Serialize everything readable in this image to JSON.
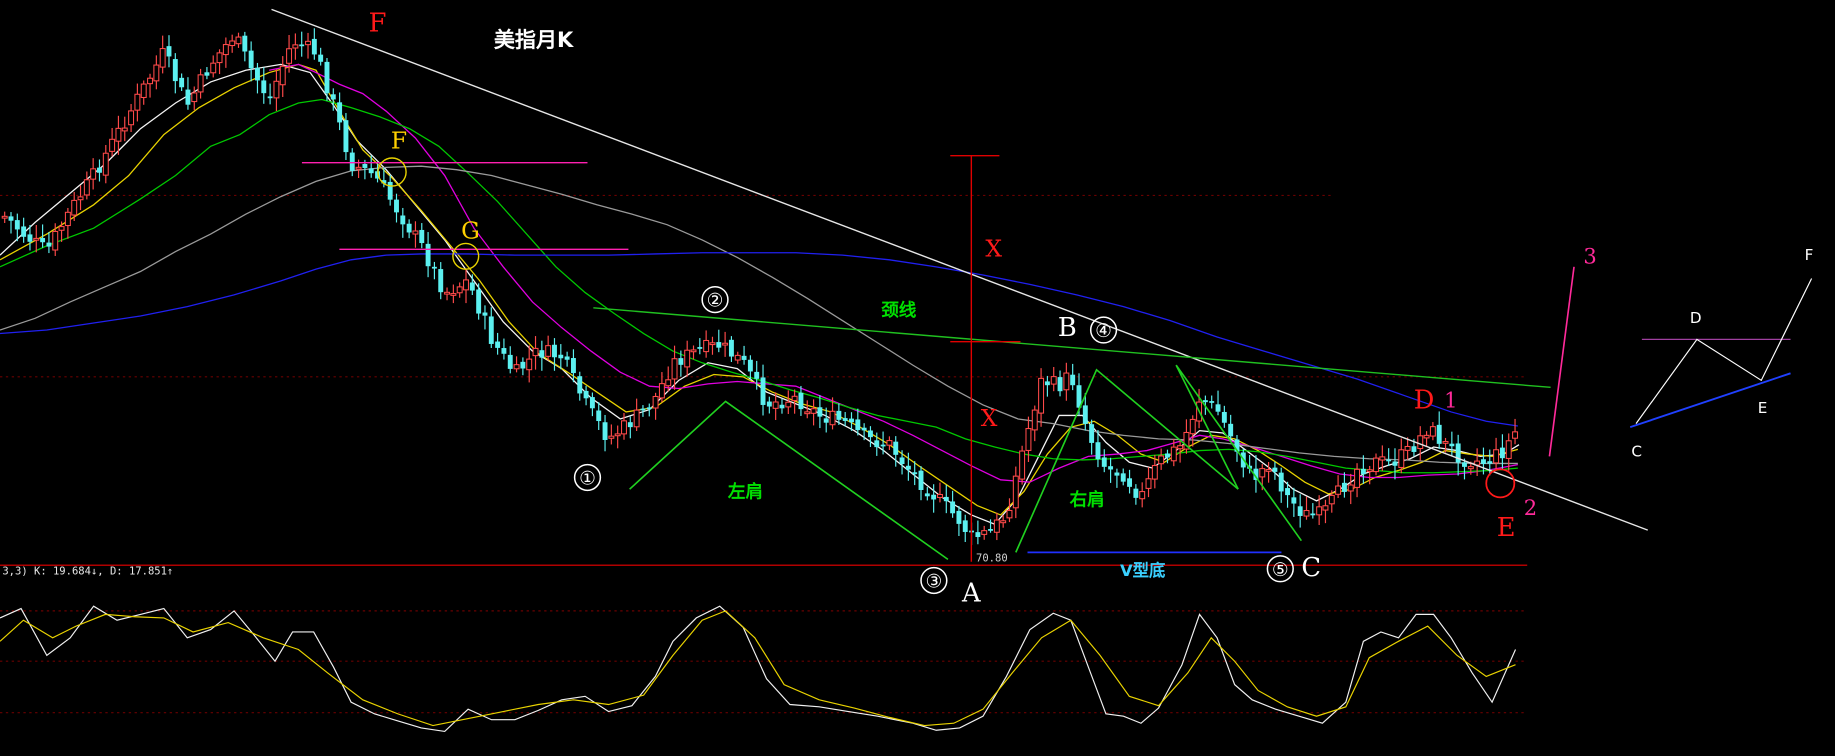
{
  "title": "美指月K",
  "indicator_text": "3,3) K: 19.684↓, D: 17.851↑",
  "chart_data": {
    "type": "candlestick",
    "title": "美指月K",
    "lows": {
      "A": "70.80"
    },
    "kdj": {
      "K": "19.684",
      "D": "17.851"
    },
    "annotations": {
      "F_top": "F",
      "F_circle": "F",
      "G_circle": "G",
      "X_upper": "X",
      "X_lower": "X",
      "neckline": "颈线",
      "left_shoulder": "左肩",
      "right_shoulder": "右肩",
      "v_bottom": "V型底",
      "n1": "①",
      "n2": "②",
      "n3": "③",
      "n4": "④",
      "n5": "⑤",
      "A": "A",
      "B": "B",
      "C": "C",
      "D": "D",
      "E": "E",
      "p1": "1",
      "p2": "2",
      "p3": "3",
      "inset_C": "C",
      "inset_D": "D",
      "inset_E": "E",
      "inset_F": "F"
    }
  }
}
